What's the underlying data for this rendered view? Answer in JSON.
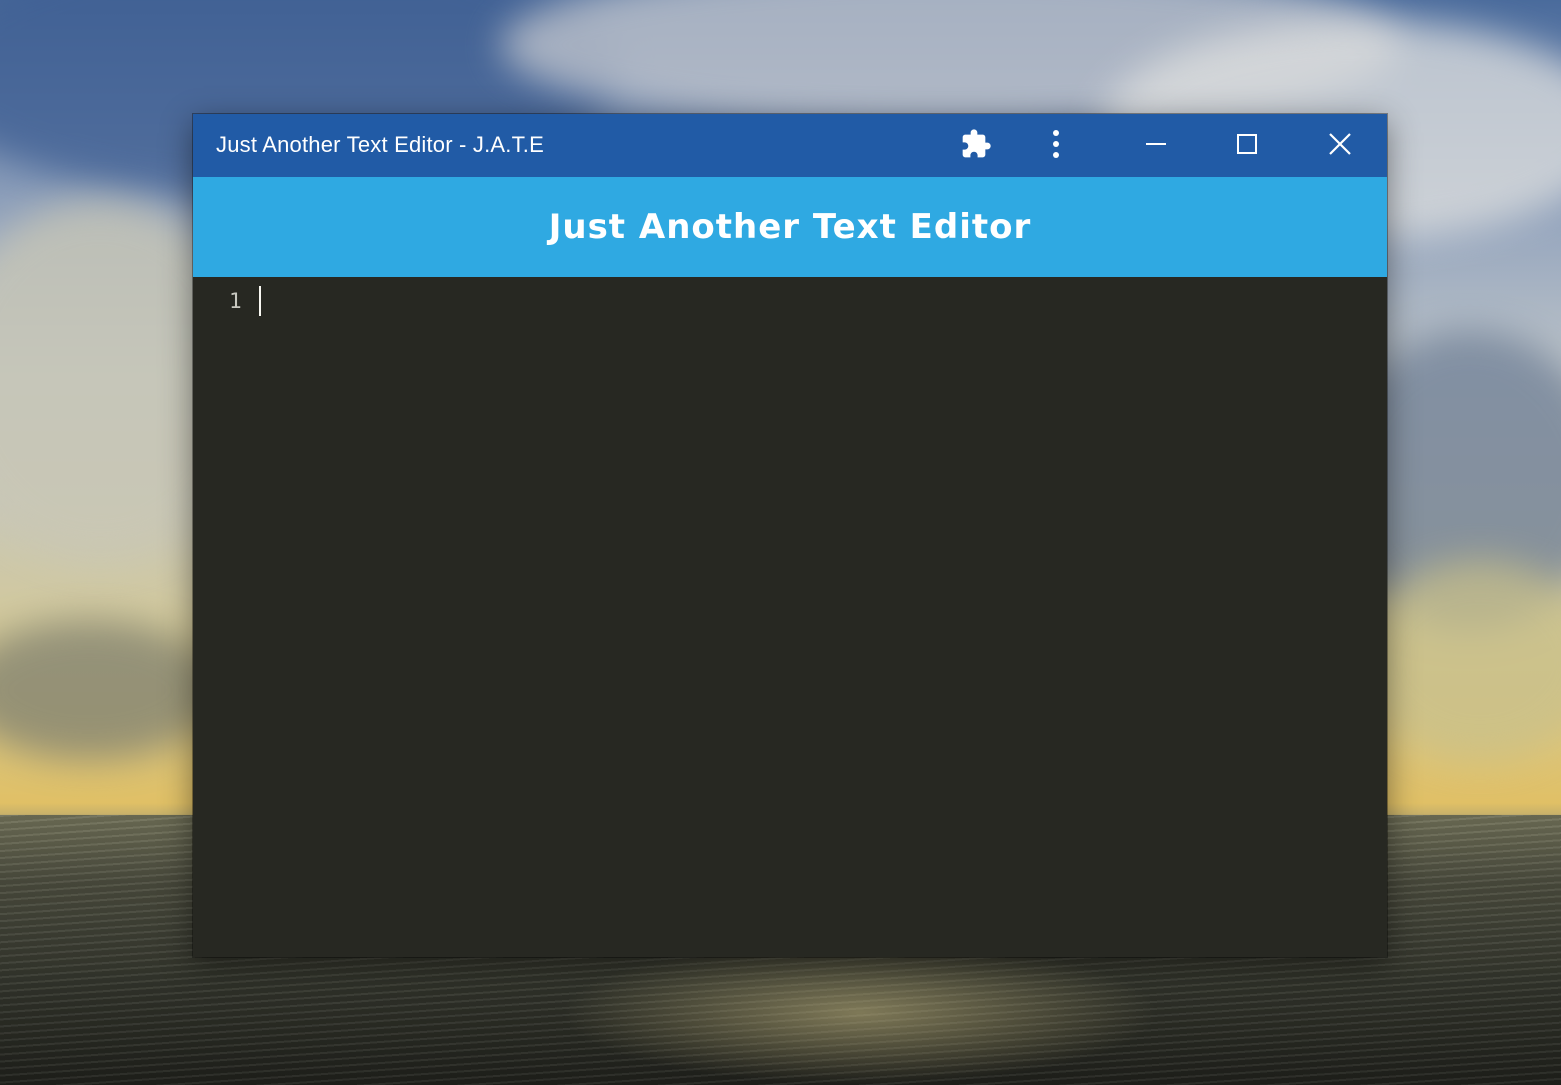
{
  "window": {
    "title": "Just Another Text Editor - J.A.T.E",
    "controls": {
      "extensions_icon": "puzzle-icon",
      "menu_icon": "more-vertical-icon",
      "minimize_icon": "minimize-icon",
      "maximize_icon": "maximize-icon",
      "close_icon": "close-icon"
    }
  },
  "header": {
    "title": "Just Another Text Editor"
  },
  "editor": {
    "line_numbers": [
      "1"
    ],
    "content": ""
  },
  "colors": {
    "titlebar": "#215ba6",
    "header": "#2fa9e2",
    "editor_bg": "#272822",
    "text_light": "#ffffff"
  }
}
